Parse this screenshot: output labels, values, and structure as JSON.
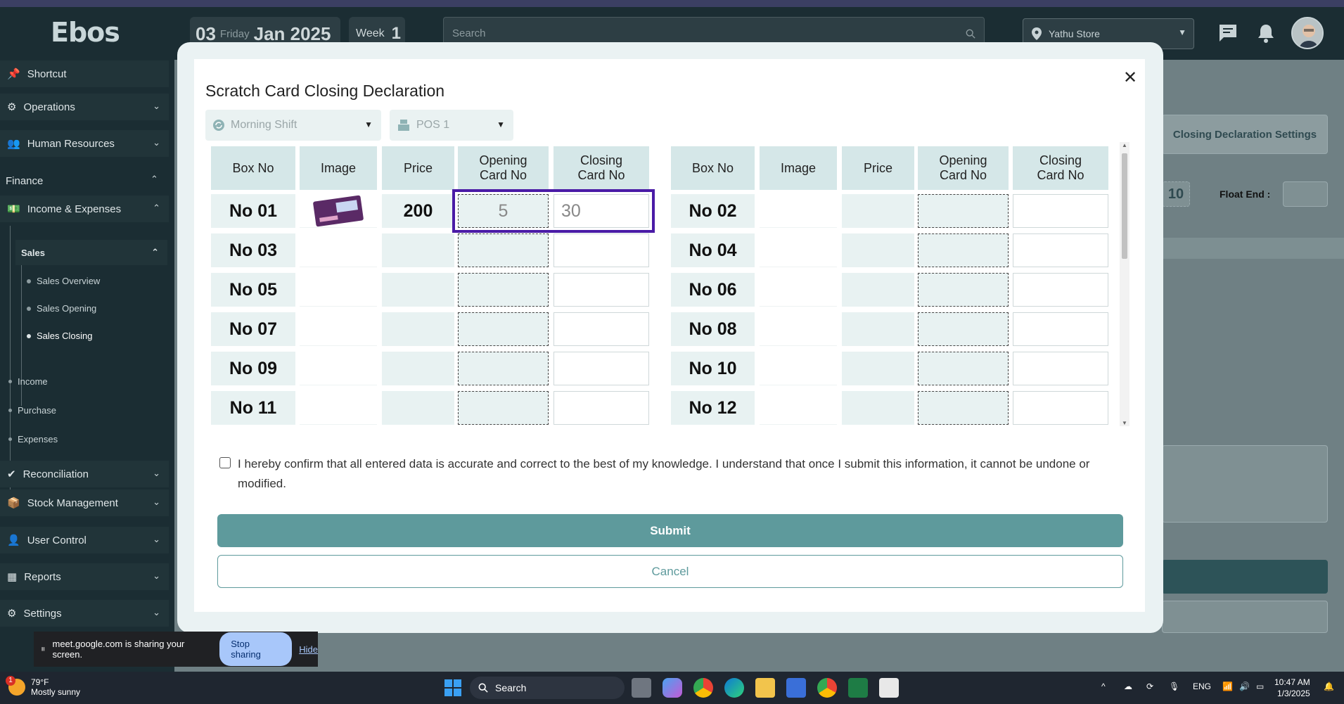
{
  "header": {
    "logo": "Ebos",
    "date_day": "03",
    "date_weekday": "Friday",
    "date_month_year": "Jan 2025",
    "week_label": "Week",
    "week_number": "1",
    "search_placeholder": "Search",
    "store": "Yathu Store"
  },
  "sidebar": {
    "shortcut": "Shortcut",
    "operations": "Operations",
    "human_resources": "Human Resources",
    "finance": "Finance",
    "income_expenses": "Income & Expenses",
    "sales": "Sales",
    "sales_overview": "Sales Overview",
    "sales_opening": "Sales Opening",
    "sales_closing": "Sales Closing",
    "income": "Income",
    "purchase": "Purchase",
    "expenses": "Expenses",
    "reconciliation": "Reconciliation",
    "stock_management": "Stock Management",
    "user_control": "User Control",
    "reports": "Reports",
    "settings": "Settings"
  },
  "background": {
    "closing_settings_btn": "Closing Declaration Settings",
    "float_value": "10",
    "float_end_label": "Float End :"
  },
  "modal": {
    "title": "Scratch Card Closing Declaration",
    "shift": "Morning Shift",
    "pos": "POS 1",
    "headers": {
      "box_no": "Box No",
      "image": "Image",
      "price": "Price",
      "opening_line1": "Opening",
      "opening_line2": "Card No",
      "closing_line1": "Closing",
      "closing_line2": "Card No"
    },
    "rows": [
      {
        "left": {
          "box": "No 01",
          "price": "200",
          "opening": "5",
          "closing": "30"
        },
        "right": {
          "box": "No 02"
        }
      },
      {
        "left": {
          "box": "No 03"
        },
        "right": {
          "box": "No 04"
        }
      },
      {
        "left": {
          "box": "No 05"
        },
        "right": {
          "box": "No 06"
        }
      },
      {
        "left": {
          "box": "No 07"
        },
        "right": {
          "box": "No 08"
        }
      },
      {
        "left": {
          "box": "No 09"
        },
        "right": {
          "box": "No 10"
        }
      },
      {
        "left": {
          "box": "No 11"
        },
        "right": {
          "box": "No 12"
        }
      }
    ],
    "confirm_text": "I hereby confirm that all entered data is accurate and correct to the best of my knowledge. I understand that once I submit this information, it cannot be undone or modified.",
    "submit": "Submit",
    "cancel": "Cancel"
  },
  "sharebar": {
    "message": "meet.google.com is sharing your screen.",
    "stop": "Stop sharing",
    "hide": "Hide"
  },
  "taskbar": {
    "badge": "1",
    "temp": "79°F",
    "weather": "Mostly sunny",
    "search": "Search",
    "lang": "ENG",
    "time": "10:47 AM",
    "date": "1/3/2025"
  }
}
